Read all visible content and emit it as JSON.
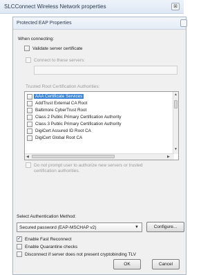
{
  "outer_window": {
    "title": "SLCConnect Wireless Network properties",
    "close_glyph": "⊠"
  },
  "dialog": {
    "title": "Protected EAP Properties",
    "when_connecting": "When connecting:",
    "validate_cert": {
      "label": "Validate server certificate",
      "checked": false
    },
    "connect_servers": {
      "label": "Connect to these servers:",
      "checked": false,
      "value": ""
    },
    "trusted_label": "Trusted Root Certification Authorities:",
    "ca_list": [
      {
        "label": "AAA Certificate Services",
        "checked": false,
        "selected": true
      },
      {
        "label": "AddTrust External CA Root",
        "checked": false,
        "selected": false
      },
      {
        "label": "Baltimore CyberTrust Root",
        "checked": false,
        "selected": false
      },
      {
        "label": "Class 2 Public Primary Certification Authority",
        "checked": false,
        "selected": false
      },
      {
        "label": "Class 3 Public Primary Certification Authority",
        "checked": false,
        "selected": false
      },
      {
        "label": "DigiCert Assured ID Root CA",
        "checked": false,
        "selected": false
      },
      {
        "label": "DigiCert Global Root CA",
        "checked": false,
        "selected": false
      }
    ],
    "no_prompt": {
      "line1": "Do not prompt user to authorize new servers or trusted",
      "line2": "certification authorities.",
      "checked": false
    },
    "select_method_label": "Select Authentication Method:",
    "method_value": "Secured password (EAP-MSCHAP v2)",
    "configure_label": "Configure...",
    "fast_reconnect": {
      "label": "Enable Fast Reconnect",
      "checked": true
    },
    "quarantine": {
      "label": "Enable Quarantine checks",
      "checked": false
    },
    "disconnect_tlv": {
      "label": "Disconnect if server does not present cryptobinding TLV",
      "checked": false
    },
    "ok_label": "OK",
    "cancel_label": "Cancel"
  }
}
